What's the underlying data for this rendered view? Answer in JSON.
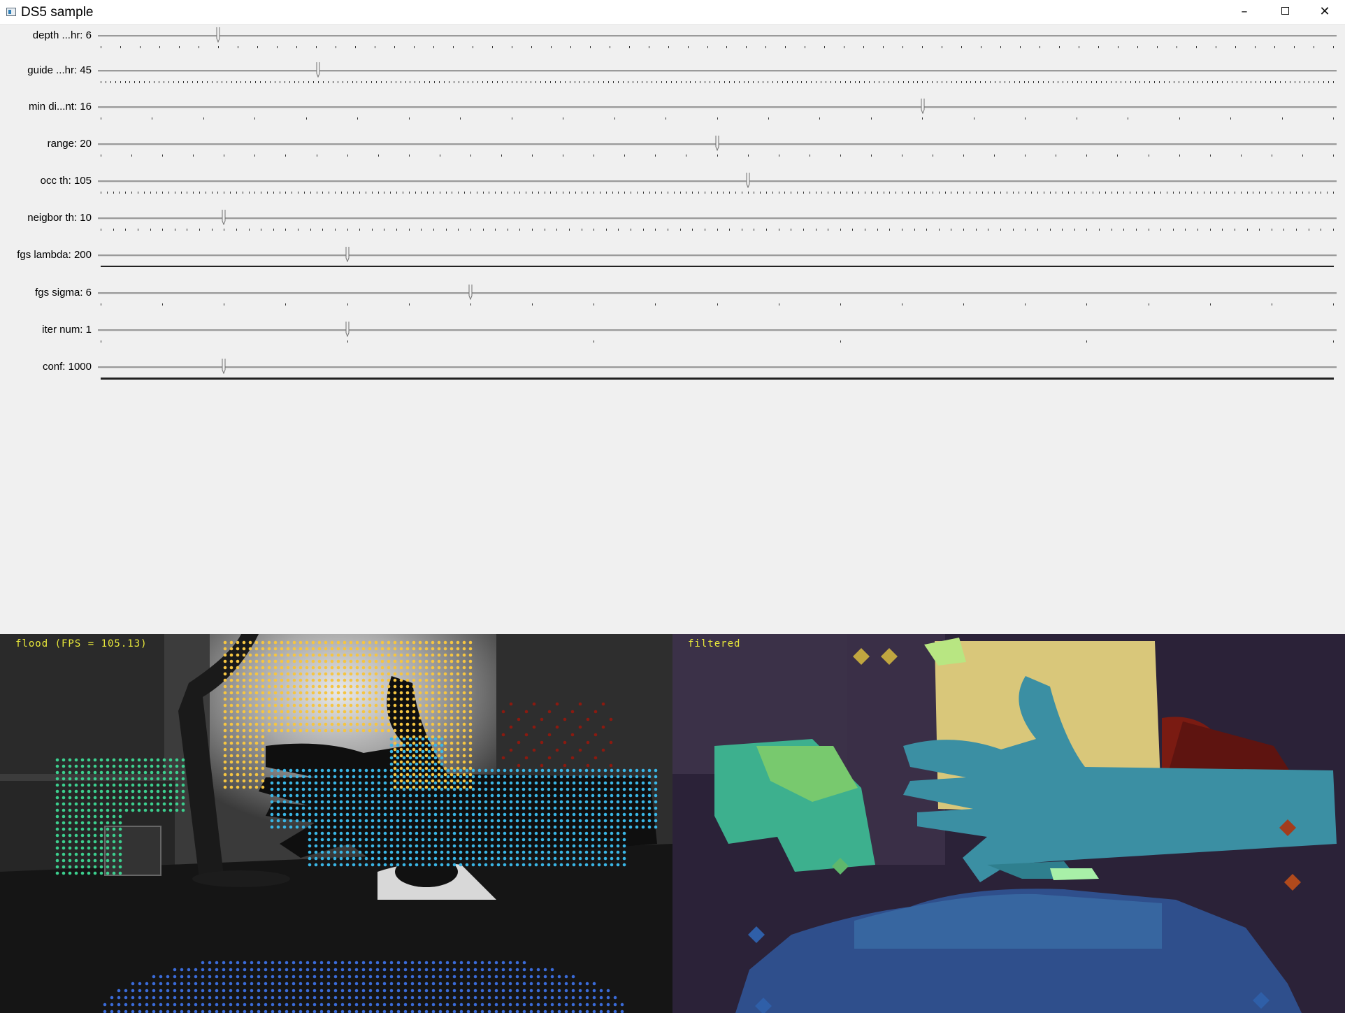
{
  "window": {
    "title": "DS5 sample",
    "icon": "app-window-icon",
    "controls": {
      "minimize": "–",
      "maximize": "maximize-icon",
      "close": "✕"
    }
  },
  "trackbars": [
    {
      "label": "depth ...hr: 6",
      "value": 6,
      "max": 63,
      "tick_count": 64
    },
    {
      "label": "guide ...hr: 45",
      "value": 45,
      "max": 255,
      "tick_count": 256
    },
    {
      "label": "min di...nt: 16",
      "value": 16,
      "max": 24,
      "tick_count": 25
    },
    {
      "label": "range: 20",
      "value": 20,
      "max": 40,
      "tick_count": 41
    },
    {
      "label": "occ th: 105",
      "value": 105,
      "max": 200,
      "tick_count": 201
    },
    {
      "label": "neigbor th: 10",
      "value": 10,
      "max": 100,
      "tick_count": 101
    },
    {
      "label": "fgs lambda: 200",
      "value": 200,
      "max": 1000,
      "tick_count": 1001
    },
    {
      "label": "fgs sigma: 6",
      "value": 6,
      "max": 20,
      "tick_count": 21
    },
    {
      "label": "iter num: 1",
      "value": 1,
      "max": 5,
      "tick_count": 6
    },
    {
      "label": "conf: 1000",
      "value": 1000,
      "max": 10000,
      "tick_count": 10001
    }
  ],
  "images": {
    "left_caption": "flood (FPS = 105.13)",
    "right_caption": "filtered"
  },
  "colors": {
    "window_bg": "#f0f0f0",
    "titlebar_bg": "#ffffff",
    "overlay_text": "#e8e83a",
    "depth_yellow": "#f5c542",
    "depth_cyan": "#3ab6e6",
    "depth_green": "#3ccf8e",
    "depth_blue": "#3a6bd8",
    "depth_red": "#8b1a10"
  }
}
